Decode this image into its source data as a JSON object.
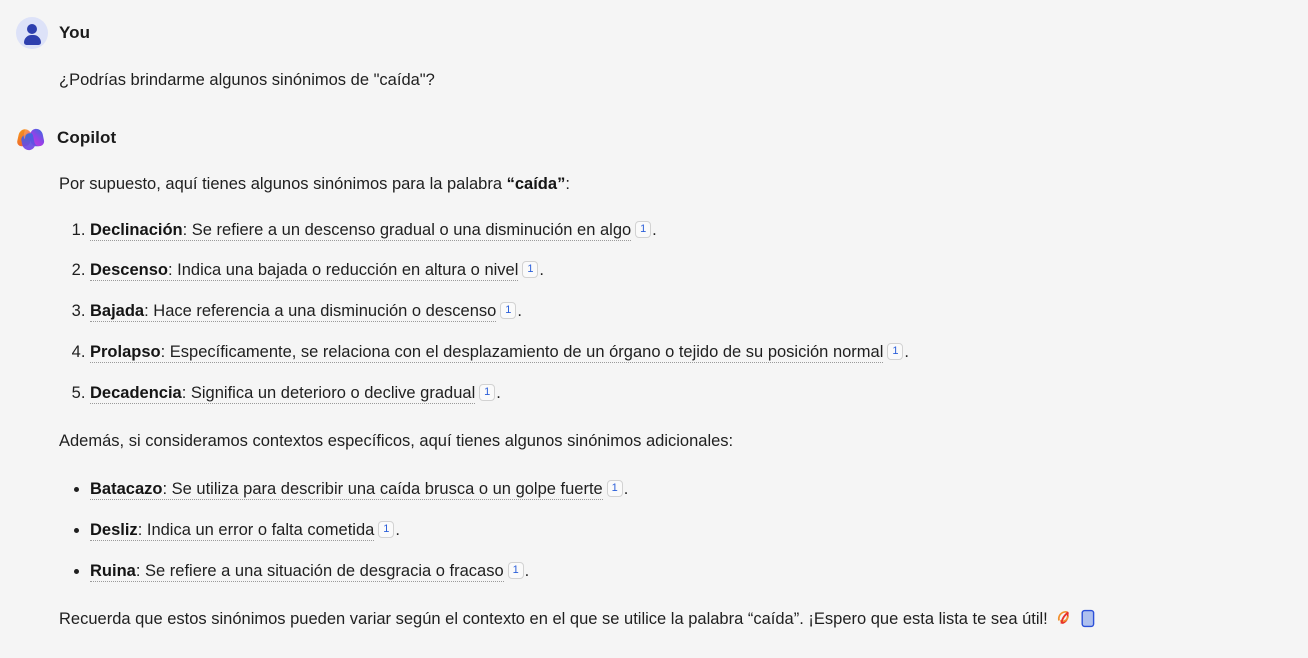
{
  "background_color": "#f5f5f5",
  "accent_color": "#2b5fd9",
  "messages": [
    {
      "role": "user",
      "author": "You",
      "avatar_icon": "user-avatar-icon",
      "text": "¿Podrías brindarme algunos sinónimos de \"caída\"?"
    },
    {
      "role": "assistant",
      "author": "Copilot",
      "avatar_icon": "copilot-logo-icon",
      "intro": {
        "before": "Por supuesto, aquí tienes algunos sinónimos para la palabra ",
        "quoted": "“caída”",
        "after": ":"
      },
      "numbered_list": [
        {
          "term": "Declinación",
          "definition": ": Se refiere a un descenso gradual o una disminución en algo",
          "citation": "1",
          "period": "."
        },
        {
          "term": "Descenso",
          "definition": ": Indica una bajada o reducción en altura o nivel",
          "citation": "1",
          "period": "."
        },
        {
          "term": "Bajada",
          "definition": ": Hace referencia a una disminución o descenso",
          "citation": "1",
          "period": "."
        },
        {
          "term": "Prolapso",
          "definition": ": Específicamente, se relaciona con el desplazamiento de un órgano o tejido de su posición normal",
          "citation": "1",
          "period": "."
        },
        {
          "term": "Decadencia",
          "definition": ": Significa un deterioro o declive gradual",
          "citation": "1",
          "period": "."
        }
      ],
      "midtext": "Además, si consideramos contextos específicos, aquí tienes algunos sinónimos adicionales:",
      "bullet_list": [
        {
          "term": "Batacazo",
          "definition": ": Se utiliza para describir una caída brusca o un golpe fuerte",
          "citation": "1",
          "period": "."
        },
        {
          "term": "Desliz",
          "definition": ": Indica un error o falta cometida",
          "citation": "1",
          "period": "."
        },
        {
          "term": "Ruina",
          "definition": ": Se refiere a una situación de desgracia o fracaso",
          "citation": "1",
          "period": "."
        }
      ],
      "closing": {
        "before": "Recuerda que estos sinónimos pueden variar según el contexto en el que se utilice la palabra ",
        "quoted": "“caída”",
        "after": ". ¡Espero que esta lista te sea útil!"
      },
      "closing_icons": [
        "leaf-icon",
        "book-icon"
      ]
    }
  ]
}
